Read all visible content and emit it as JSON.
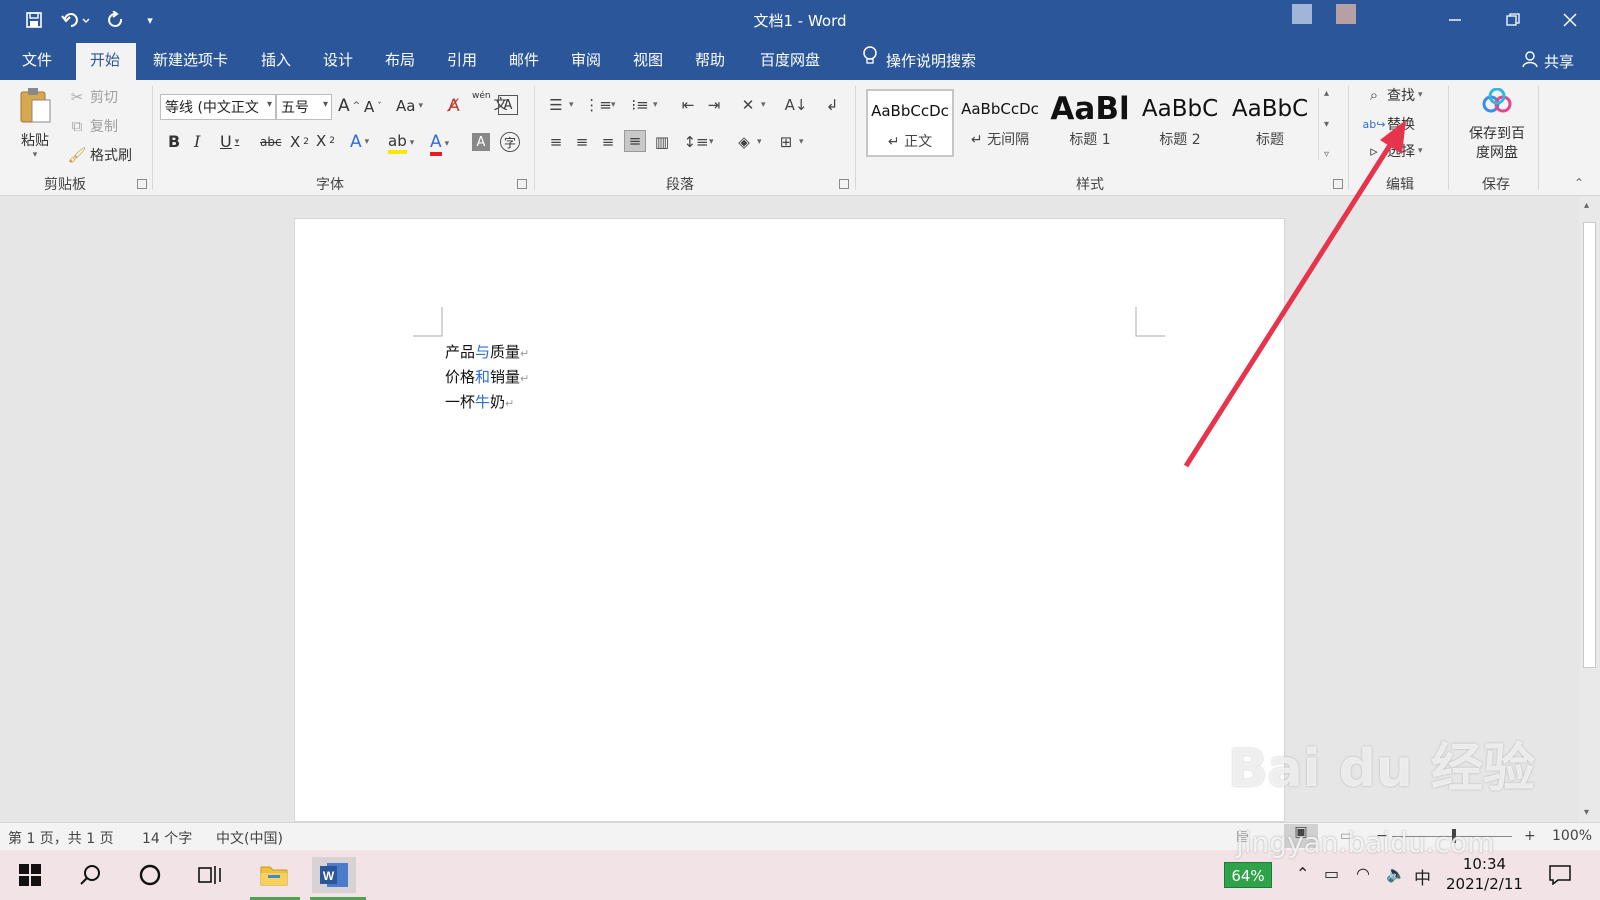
{
  "window": {
    "title": "文档1  -  Word"
  },
  "tabs": [
    {
      "label": "文件"
    },
    {
      "label": "开始"
    },
    {
      "label": "新建选项卡"
    },
    {
      "label": "插入"
    },
    {
      "label": "设计"
    },
    {
      "label": "布局"
    },
    {
      "label": "引用"
    },
    {
      "label": "邮件"
    },
    {
      "label": "审阅"
    },
    {
      "label": "视图"
    },
    {
      "label": "帮助"
    },
    {
      "label": "百度网盘"
    }
  ],
  "tell_me": "操作说明搜索",
  "share": "共享",
  "clipboard": {
    "paste": "粘贴",
    "cut": "剪切",
    "copy": "复制",
    "format_painter": "格式刷",
    "label": "剪贴板"
  },
  "font": {
    "name": "等线 (中文正文",
    "size": "五号",
    "label": "字体"
  },
  "paragraph": {
    "label": "段落"
  },
  "styles": {
    "label": "样式",
    "items": [
      {
        "preview": "AaBbCcDc",
        "name": "↵ 正文"
      },
      {
        "preview": "AaBbCcDc",
        "name": "↵ 无间隔"
      },
      {
        "preview": "AaBl",
        "name": "标题 1"
      },
      {
        "preview": "AaBbC",
        "name": "标题 2"
      },
      {
        "preview": "AaBbC",
        "name": "标题"
      }
    ]
  },
  "editing": {
    "find": "查找",
    "replace": "替换",
    "select": "选择",
    "label": "编辑"
  },
  "save_group": {
    "button": "保存到百度网盘",
    "label": "保存"
  },
  "document": {
    "lines": [
      {
        "a": "产品",
        "b": "与",
        "c": "质量"
      },
      {
        "a": "价格",
        "b": "和",
        "c": "销量"
      },
      {
        "a": "一杯",
        "b": "牛",
        "c": "奶"
      }
    ]
  },
  "status": {
    "page": "第 1 页，共 1 页",
    "words": "14 个字",
    "lang": "中文(中国)",
    "zoom": "100%"
  },
  "taskbar": {
    "battery": "64%",
    "ime": "中",
    "time": "10:34",
    "date": "2021/2/11"
  },
  "watermark": {
    "brand": "Bai du 经验",
    "url": "jingyan.baidu.com"
  },
  "colors": {
    "accent": "#2b579a",
    "arrow": "#e5344c"
  }
}
